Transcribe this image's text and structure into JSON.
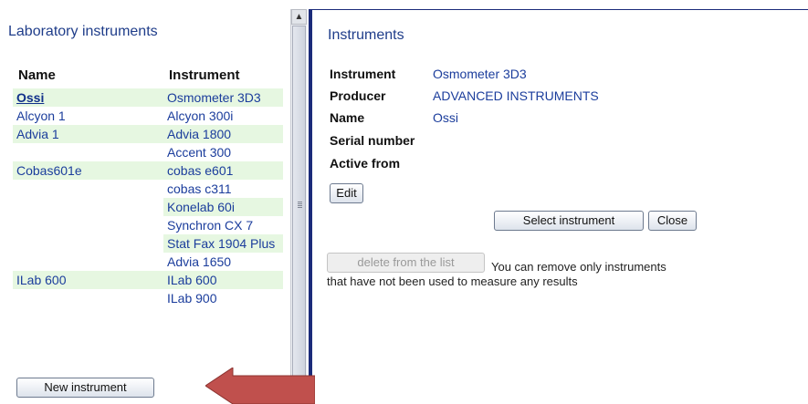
{
  "left_panel": {
    "title": "Laboratory instruments",
    "headers": {
      "name": "Name",
      "instrument": "Instrument"
    },
    "rows": [
      {
        "name": "Ossi",
        "instrument": "Osmometer 3D3"
      },
      {
        "name": "Alcyon 1",
        "instrument": "Alcyon 300i"
      },
      {
        "name": "Advia 1",
        "instrument": "Advia 1800"
      },
      {
        "name": "",
        "instrument": "Accent 300"
      },
      {
        "name": "Cobas601e",
        "instrument": "cobas e601"
      },
      {
        "name": "",
        "instrument": "cobas c311"
      },
      {
        "name": "",
        "instrument": "Konelab 60i"
      },
      {
        "name": "",
        "instrument": "Synchron CX 7"
      },
      {
        "name": "",
        "instrument": "Stat Fax 1904 Plus"
      },
      {
        "name": "",
        "instrument": "Advia 1650"
      },
      {
        "name": "ILab 600",
        "instrument": "ILab 600"
      },
      {
        "name": "",
        "instrument": "ILab 900"
      }
    ],
    "new_button": "New instrument"
  },
  "right_panel": {
    "title": "Instruments",
    "fields": [
      {
        "label": "Instrument",
        "value": "Osmometer 3D3"
      },
      {
        "label": "Producer",
        "value": "ADVANCED INSTRUMENTS"
      },
      {
        "label": "Name",
        "value": "Ossi"
      },
      {
        "label": "Serial number",
        "value": ""
      },
      {
        "label": "Active from",
        "value": ""
      }
    ],
    "edit_button": "Edit",
    "select_button": "Select instrument",
    "close_button": "Close",
    "delete_button": "delete from the list",
    "delete_note_line1": "You can remove only instruments",
    "delete_note_line2": "that have not been used to measure any results"
  },
  "colors": {
    "accent": "#1b2b7a",
    "row_shade": "#e6f7e1",
    "arrow": "#c0504d"
  },
  "icons": {
    "scroll_up": "chevron-up-icon",
    "arrow": "arrow-left-icon"
  }
}
